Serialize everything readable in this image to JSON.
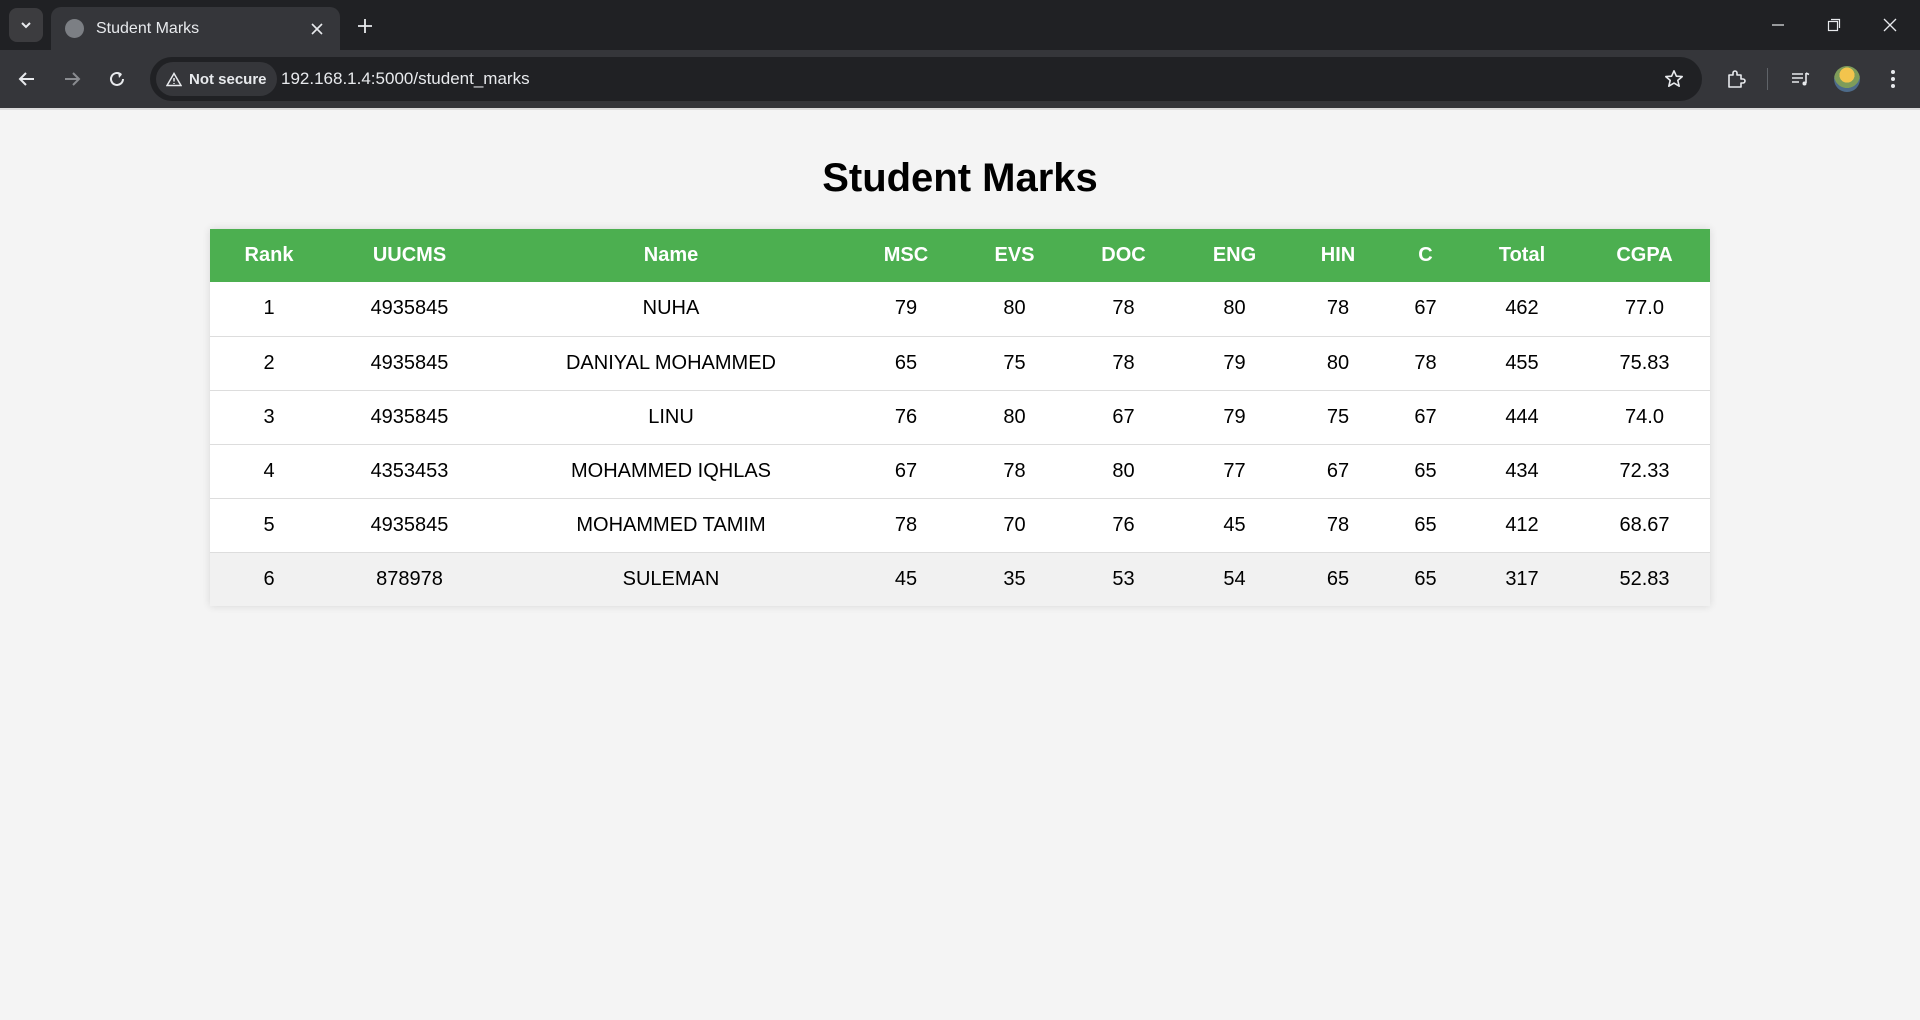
{
  "browser": {
    "tab_title": "Student Marks",
    "security_label": "Not secure",
    "url": "192.168.1.4:5000/student_marks",
    "icons": [
      "tab-search-icon",
      "globe-icon",
      "close-icon",
      "plus-icon",
      "minimize-icon",
      "restore-icon",
      "back-icon",
      "forward-icon",
      "reload-icon",
      "warning-icon",
      "star-icon",
      "extensions-icon",
      "media-icon",
      "avatar",
      "menu-icon"
    ]
  },
  "page": {
    "title": "Student Marks",
    "accent_color": "#4caf50"
  },
  "table": {
    "headers": [
      "Rank",
      "UUCMS",
      "Name",
      "MSC",
      "EVS",
      "DOC",
      "ENG",
      "HIN",
      "C",
      "Total",
      "CGPA"
    ],
    "rows": [
      [
        "1",
        "4935845",
        "NUHA",
        "79",
        "80",
        "78",
        "80",
        "78",
        "67",
        "462",
        "77.0"
      ],
      [
        "2",
        "4935845",
        "DANIYAL MOHAMMED",
        "65",
        "75",
        "78",
        "79",
        "80",
        "78",
        "455",
        "75.83"
      ],
      [
        "3",
        "4935845",
        "LINU",
        "76",
        "80",
        "67",
        "79",
        "75",
        "67",
        "444",
        "74.0"
      ],
      [
        "4",
        "4353453",
        "MOHAMMED IQHLAS",
        "67",
        "78",
        "80",
        "77",
        "67",
        "65",
        "434",
        "72.33"
      ],
      [
        "5",
        "4935845",
        "MOHAMMED TAMIM",
        "78",
        "70",
        "76",
        "45",
        "78",
        "65",
        "412",
        "68.67"
      ],
      [
        "6",
        "878978",
        "SULEMAN",
        "45",
        "35",
        "53",
        "54",
        "65",
        "65",
        "317",
        "52.83"
      ]
    ],
    "hovered_row_index": 5
  }
}
